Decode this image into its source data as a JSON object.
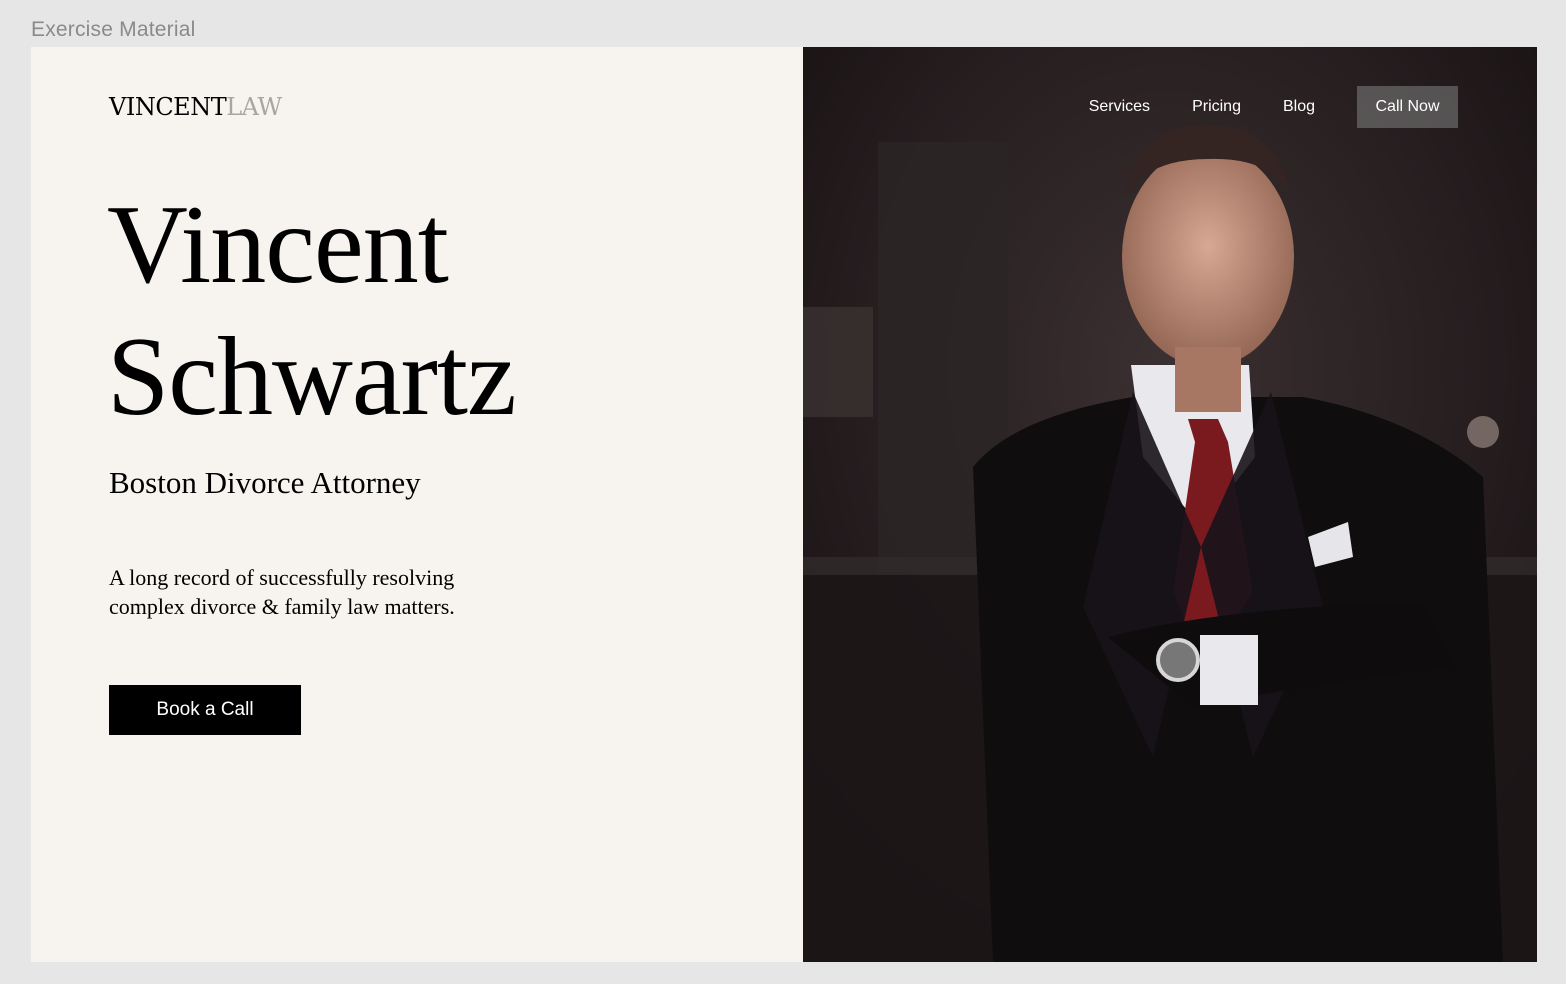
{
  "canvas": {
    "label": "Exercise Material"
  },
  "logo": {
    "strong": "VINCENT",
    "light": "LAW"
  },
  "hero": {
    "first_name": "Vincent",
    "last_name": "Schwartz",
    "subtitle": "Boston Divorce Attorney",
    "description": "A long record of successfully resolving complex divorce & family law matters.",
    "cta_label": "Book a Call"
  },
  "nav": {
    "items": [
      {
        "label": "Services"
      },
      {
        "label": "Pricing"
      },
      {
        "label": "Blog"
      }
    ],
    "call_label": "Call Now"
  },
  "colors": {
    "left_background": "#f7f3ee",
    "logo_light": "#a9a6a2",
    "cta_background": "#000000",
    "photo_background": "#1c1516",
    "tie": "#7a1a1f"
  }
}
